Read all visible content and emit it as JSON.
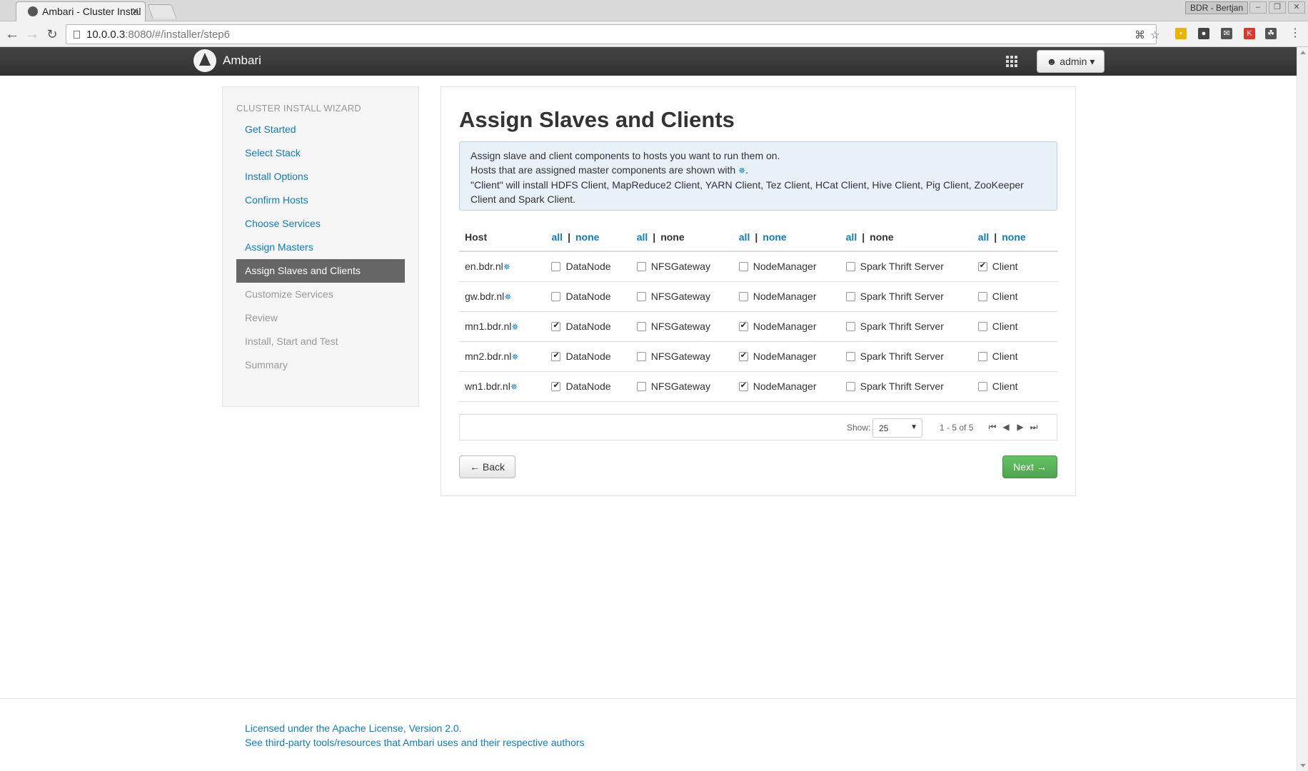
{
  "browser": {
    "tab_title": "Ambari - Cluster Instal",
    "profile": "BDR - Bertjan",
    "url_host": "10.0.0.3",
    "url_rest": ":8080/#/installer/step6"
  },
  "app": {
    "brand": "Ambari",
    "user": "admin"
  },
  "wizard": {
    "title": "CLUSTER INSTALL WIZARD",
    "steps": [
      {
        "label": "Get Started",
        "state": "link"
      },
      {
        "label": "Select Stack",
        "state": "link"
      },
      {
        "label": "Install Options",
        "state": "link"
      },
      {
        "label": "Confirm Hosts",
        "state": "link"
      },
      {
        "label": "Choose Services",
        "state": "link"
      },
      {
        "label": "Assign Masters",
        "state": "link"
      },
      {
        "label": "Assign Slaves and Clients",
        "state": "active"
      },
      {
        "label": "Customize Services",
        "state": "disabled"
      },
      {
        "label": "Review",
        "state": "disabled"
      },
      {
        "label": "Install, Start and Test",
        "state": "disabled"
      },
      {
        "label": "Summary",
        "state": "disabled"
      }
    ]
  },
  "main": {
    "title": "Assign Slaves and Clients",
    "info_line1": "Assign slave and client components to hosts you want to run them on.",
    "info_line2_pre": "Hosts that are assigned master components are shown with",
    "info_line2_post": ".",
    "info_line3": "\"Client\" will install HDFS Client, MapReduce2 Client, YARN Client, Tez Client, HCat Client, Hive Client, Pig Client, ZooKeeper Client and Spark Client.",
    "master_marker": "✵"
  },
  "table": {
    "host_header": "Host",
    "all_label": "all",
    "none_label": "none",
    "components": [
      "DataNode",
      "NFSGateway",
      "NodeManager",
      "Spark Thrift Server",
      "Client"
    ],
    "rows": [
      {
        "host": "en.bdr.nl",
        "checked": [
          false,
          false,
          false,
          false,
          true
        ]
      },
      {
        "host": "gw.bdr.nl",
        "checked": [
          false,
          false,
          false,
          false,
          false
        ]
      },
      {
        "host": "mn1.bdr.nl",
        "checked": [
          true,
          false,
          true,
          false,
          false
        ]
      },
      {
        "host": "mn2.bdr.nl",
        "checked": [
          true,
          false,
          true,
          false,
          false
        ]
      },
      {
        "host": "wn1.bdr.nl",
        "checked": [
          true,
          false,
          true,
          false,
          false
        ]
      }
    ]
  },
  "pager": {
    "show_label": "Show:",
    "page_size": "25",
    "range": "1 - 5 of 5"
  },
  "buttons": {
    "back": "← Back",
    "next": "Next →"
  },
  "footer": {
    "license": "Licensed under the Apache License, Version 2.0.",
    "third_party": "See third-party tools/resources that Ambari uses and their respective authors"
  }
}
